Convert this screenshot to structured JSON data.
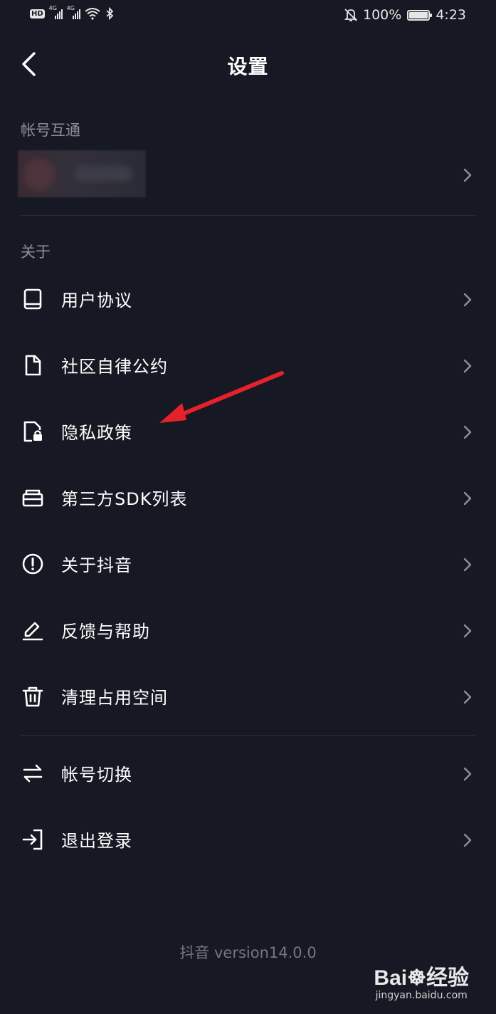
{
  "status_bar": {
    "hd": "HD",
    "network_1": "4G",
    "network_2": "4G",
    "battery": "100%",
    "time": "4:23"
  },
  "header": {
    "title": "设置"
  },
  "sections": {
    "account_sync": {
      "label": "帐号互通"
    },
    "about": {
      "label": "关于"
    }
  },
  "menu": {
    "about_items": [
      {
        "label": "用户协议",
        "icon": "book-icon"
      },
      {
        "label": "社区自律公约",
        "icon": "document-icon"
      },
      {
        "label": "隐私政策",
        "icon": "privacy-lock-icon"
      },
      {
        "label": "第三方SDK列表",
        "icon": "briefcase-icon"
      },
      {
        "label": "关于抖音",
        "icon": "info-circle-icon"
      },
      {
        "label": "反馈与帮助",
        "icon": "pencil-icon"
      },
      {
        "label": "清理占用空间",
        "icon": "trash-icon"
      }
    ],
    "account_items": [
      {
        "label": "帐号切换",
        "icon": "switch-arrows-icon"
      },
      {
        "label": "退出登录",
        "icon": "logout-icon"
      }
    ]
  },
  "footer": {
    "version": "抖音 version14.0.0"
  },
  "annotation": {
    "arrow_color": "#e5222b"
  },
  "watermark": {
    "brand": "Bai",
    "brand_suffix": "经验",
    "url": "jingyan.baidu.com"
  },
  "colors": {
    "background": "#161823",
    "muted_text": "#8e8f96",
    "divider": "#2b2c36"
  }
}
